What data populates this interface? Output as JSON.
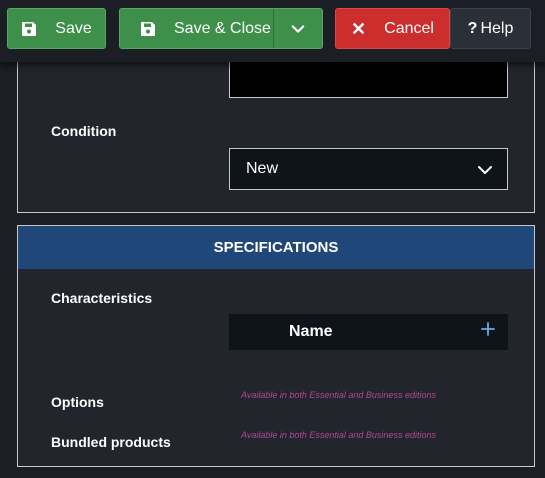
{
  "toolbar": {
    "save_label": "Save",
    "save_close_label": "Save & Close",
    "cancel_label": "Cancel",
    "help_label": "Help"
  },
  "form": {
    "condition_label": "Condition",
    "condition_value": "New"
  },
  "specifications": {
    "header": "SPECIFICATIONS",
    "characteristics_label": "Characteristics",
    "name_column": "Name",
    "options_label": "Options",
    "options_note": "Available in both Essential and Business editions",
    "bundled_label": "Bundled products",
    "bundled_note": "Available in both Essential and Business editions"
  },
  "colors": {
    "save_green": "#3d8f49",
    "cancel_red": "#cc2d2d",
    "header_blue": "#1f4779",
    "note_magenta": "#b0479a"
  }
}
